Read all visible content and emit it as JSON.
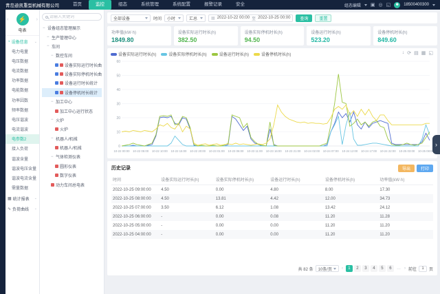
{
  "topbar": {
    "company": "青岛迪凯重型机械有限公司",
    "nav_items": [
      {
        "label": "首页",
        "active": false
      },
      {
        "label": "监控",
        "active": true
      },
      {
        "label": "组态",
        "active": false
      },
      {
        "label": "系统管理",
        "active": false
      },
      {
        "label": "系统配置",
        "active": false
      },
      {
        "label": "报警记录",
        "active": false
      },
      {
        "label": "安全",
        "active": false
      }
    ],
    "edit_label": "组态编辑",
    "icons": [
      {
        "name": "copy-icon",
        "glyph": "▣"
      },
      {
        "name": "location-icon",
        "glyph": "◎"
      },
      {
        "name": "fullscreen-icon",
        "glyph": "◱"
      }
    ],
    "avatar_glyph": "☻",
    "user_phone": "18500400300"
  },
  "sidebar": {
    "device_icon_glyph": "⚡",
    "device_label": "电表",
    "prev_caret": "‹",
    "next_caret": "›",
    "section": {
      "icon_glyph": "◔",
      "label": "设备信息",
      "caret": "⌄"
    },
    "items": [
      {
        "label": "电力电量",
        "active": false
      },
      {
        "label": "电压数据",
        "active": false
      },
      {
        "label": "电流数据",
        "active": false
      },
      {
        "label": "功率数据",
        "active": false
      },
      {
        "label": "电能数据",
        "active": false
      },
      {
        "label": "功率因数",
        "active": false
      },
      {
        "label": "频率数据",
        "active": false
      },
      {
        "label": "电压谐波",
        "active": false
      },
      {
        "label": "电流谐波",
        "active": false
      },
      {
        "label": "电参数2",
        "active": true
      },
      {
        "label": "接入负荷",
        "active": false
      },
      {
        "label": "谐波含量",
        "active": false
      },
      {
        "label": "谐波电压含量",
        "active": false
      },
      {
        "label": "谐波电流含量",
        "active": false
      },
      {
        "label": "需量数据",
        "active": false
      }
    ],
    "sections_bottom": [
      {
        "icon_glyph": "▦",
        "label": "统计报表",
        "caret": "⌄"
      },
      {
        "icon_glyph": "∿",
        "label": "负荷曲线",
        "caret": "⌄"
      }
    ]
  },
  "tree": {
    "search_placeholder": "请输入关键词",
    "nodes": [
      {
        "depth": 0,
        "label": "设备组态管理展示",
        "group": true,
        "icons": [],
        "selected": false
      },
      {
        "depth": 1,
        "label": "生产管理中心",
        "group": true,
        "icons": [],
        "selected": false
      },
      {
        "depth": 1,
        "label": "车间",
        "group": true,
        "icons": [],
        "selected": false
      },
      {
        "depth": 2,
        "label": "数控车间",
        "group": true,
        "icons": [],
        "selected": false
      },
      {
        "depth": 3,
        "label": "设备实际运行时长曲线",
        "group": false,
        "icons": [
          "blue",
          "red"
        ],
        "selected": false
      },
      {
        "depth": 3,
        "label": "设备实际停机时长曲线",
        "group": false,
        "icons": [
          "blue",
          "red"
        ],
        "selected": false
      },
      {
        "depth": 3,
        "label": "设备运行时长统计",
        "group": false,
        "icons": [
          "blue",
          "red"
        ],
        "selected": false
      },
      {
        "depth": 3,
        "label": "设备停机时长统计",
        "group": false,
        "icons": [
          "blue",
          "red"
        ],
        "selected": true
      },
      {
        "depth": 2,
        "label": "加工中心",
        "group": true,
        "icons": [],
        "selected": false
      },
      {
        "depth": 3,
        "label": "加工中心运行状态",
        "group": false,
        "icons": [
          "red"
        ],
        "selected": false
      },
      {
        "depth": 2,
        "label": "火炉",
        "group": true,
        "icons": [],
        "selected": false
      },
      {
        "depth": 3,
        "label": "火炉",
        "group": false,
        "icons": [
          "red"
        ],
        "selected": false
      },
      {
        "depth": 2,
        "label": "机器人/机械",
        "group": true,
        "icons": [],
        "selected": false
      },
      {
        "depth": 3,
        "label": "机器人/机械",
        "group": false,
        "icons": [
          "red"
        ],
        "selected": false
      },
      {
        "depth": 2,
        "label": "气体检测仪表",
        "group": true,
        "icons": [],
        "selected": false
      },
      {
        "depth": 3,
        "label": "圆形仪表",
        "group": false,
        "icons": [
          "red"
        ],
        "selected": false
      },
      {
        "depth": 3,
        "label": "数字仪表",
        "group": false,
        "icons": [
          "red"
        ],
        "selected": false
      },
      {
        "depth": 2,
        "label": "动力车间总电表",
        "group": false,
        "icons": [
          "red"
        ],
        "selected": false
      }
    ]
  },
  "filters": {
    "device_select": "全部设备",
    "time_label": "时间",
    "unit_select": "小时",
    "mode_select": "汇总",
    "calendar_glyph": "▦",
    "date_start": "2022-10-22 00:00",
    "date_sep": "至",
    "date_end": "2022-10-25 00:00",
    "search_btn": "查询",
    "reset_btn": "重置"
  },
  "stats": {
    "cards": [
      {
        "label": "功率值(kW·h)",
        "value": "1849.80",
        "color": "#1c8f7e"
      },
      {
        "label": "设备实际运行时长(h)",
        "value": "382.50",
        "color": "#52b54f"
      },
      {
        "label": "设备实际停机时长(h)",
        "value": "94.50",
        "color": "#52b54f"
      },
      {
        "label": "设备运行时长(h)",
        "value": "523.20",
        "color": "#23b7a4"
      },
      {
        "label": "设备停机时长(h)",
        "value": "849.60",
        "color": "#23b7a4"
      }
    ]
  },
  "chart_toolbox": [
    {
      "name": "download-icon",
      "glyph": "↓"
    },
    {
      "name": "refresh-icon",
      "glyph": "⟳"
    },
    {
      "name": "data-view-icon",
      "glyph": "▤"
    },
    {
      "name": "chart-type-icon",
      "glyph": "▦"
    },
    {
      "name": "fullscreen-icon",
      "glyph": "◱"
    }
  ],
  "chart_data": {
    "type": "line",
    "title": "",
    "xlabel": "",
    "ylabel": "",
    "ylim": [
      0,
      60
    ],
    "y_ticks": [
      0,
      10,
      20,
      30,
      40,
      50,
      60
    ],
    "grid": true,
    "legend_position": "top-left",
    "x_label_step": 5,
    "x_labels": [
      "10-22 00:00",
      "10-22 05:00",
      "10-22 10:00",
      "10-22 15:00",
      "10-22 20:00",
      "10-23 01:00",
      "10-23 06:00",
      "10-23 11:00",
      "10-23 16:00",
      "10-23 21:00",
      "10-24 02:00",
      "10-24 07:00",
      "10-24 12:00",
      "10-24 17:00",
      "10-24 22:00",
      "10-25 03:00",
      "10-25 08:00"
    ],
    "series": [
      {
        "name": "设备实际运行时长(h)",
        "color": "#4f6bd0",
        "values": [
          0,
          0,
          0,
          0.5,
          0,
          0,
          0,
          0.5,
          1,
          7,
          20,
          20.5,
          20,
          21,
          16,
          15,
          20,
          19,
          12,
          0.5,
          0,
          0,
          0,
          0,
          0,
          0,
          0,
          0,
          1,
          21,
          19,
          15,
          11,
          14,
          5,
          2,
          1,
          0,
          0,
          12,
          1,
          0,
          0,
          0,
          0,
          0,
          0,
          0,
          0,
          0,
          0,
          0,
          0,
          0,
          1,
          10,
          16,
          24,
          20,
          23,
          17,
          24,
          15,
          12,
          17,
          13,
          16,
          17,
          18,
          17,
          16,
          2,
          1,
          1,
          1,
          1,
          1,
          1,
          1,
          3,
          9,
          4
        ]
      },
      {
        "name": "设备实际停机时长(h)",
        "color": "#67c5e3",
        "values": [
          0,
          0,
          0,
          0,
          0,
          0,
          0,
          0,
          0,
          0,
          0,
          0,
          0,
          2,
          7,
          4,
          1,
          0,
          0,
          0,
          0,
          0,
          0,
          0,
          0,
          0,
          0,
          0,
          0,
          0,
          0,
          0,
          0,
          0,
          0,
          0,
          0,
          0,
          0,
          0,
          0,
          0,
          0,
          0,
          0,
          0,
          0,
          0,
          0,
          0,
          0,
          0,
          0,
          0,
          0,
          10,
          15,
          21,
          1,
          15,
          24,
          5,
          0.5,
          0.5,
          1,
          1.5,
          2,
          2,
          1.5,
          1,
          0.5,
          0,
          0,
          0,
          0,
          0,
          0,
          0,
          0,
          5,
          15,
          8
        ]
      },
      {
        "name": "设备运行时长(h)",
        "color": "#9cc641",
        "values": [
          0,
          0.5,
          1,
          2,
          1,
          0.5,
          0,
          1,
          2,
          8,
          21,
          21.5,
          21,
          22,
          15,
          16,
          21,
          20,
          13,
          1,
          0,
          0.5,
          0,
          0,
          0.5,
          0,
          0,
          0.5,
          2,
          22,
          21,
          20,
          13,
          16,
          6,
          3,
          1,
          0.5,
          0,
          17,
          0.5,
          0,
          0,
          0,
          0,
          0,
          0,
          0,
          0,
          0,
          0,
          0,
          0,
          1,
          2,
          15,
          30,
          51,
          31,
          30,
          14,
          16,
          19,
          15,
          17,
          14,
          17,
          18,
          14,
          13,
          5,
          1,
          0.5,
          0.5,
          1,
          2,
          1,
          0.5,
          1,
          2,
          6,
          10
        ]
      },
      {
        "name": "设备停机时长(h)",
        "color": "#ecd94a",
        "values": [
          10,
          10.5,
          10,
          11,
          10.5,
          10,
          11,
          10.5,
          10,
          12,
          15,
          14,
          16,
          13,
          12,
          16,
          10,
          14,
          12,
          2,
          0.5,
          1,
          1.5,
          0.5,
          1,
          1.5,
          0.5,
          1,
          1.5,
          1,
          2,
          1,
          1.5,
          1,
          0.5,
          1,
          1.5,
          1,
          2,
          5,
          15,
          29,
          24,
          21,
          19,
          18,
          17,
          16.5,
          17,
          16,
          16.5,
          16,
          16,
          15.5,
          16,
          20,
          26,
          28,
          26,
          29,
          22,
          25,
          21,
          26,
          22,
          26,
          21,
          18,
          22,
          22,
          18,
          15,
          15,
          15,
          15,
          15,
          15,
          15,
          15,
          15,
          16,
          16
        ]
      }
    ]
  },
  "table": {
    "title": "历史记录",
    "buttons": [
      {
        "label": "导出",
        "type": "warning"
      },
      {
        "label": "打印",
        "type": "blue"
      }
    ],
    "columns": [
      "时间",
      "设备实际运行时长(h)",
      "设备实际停机时长(h)",
      "设备运行时长(h)",
      "设备停机时长(h)",
      "功率值(kW·h)"
    ],
    "rows": [
      [
        "2022-10-25 09:00:00",
        "4.50",
        "0.00",
        "4.80",
        "8.00",
        "17.30"
      ],
      [
        "2022-10-25 08:00:00",
        "4.50",
        "13.81",
        "4.42",
        "12.00",
        "34.73"
      ],
      [
        "2022-10-25 07:00:00",
        "3.50",
        "6.12",
        "1.08",
        "13.42",
        "24.12"
      ],
      [
        "2022-10-25 06:00:00",
        "-",
        "0.00",
        "0.08",
        "11.20",
        "11.28"
      ],
      [
        "2022-10-25 05:00:00",
        "-",
        "0.00",
        "0.00",
        "11.20",
        "11.20"
      ],
      [
        "2022-10-25 04:00:00",
        "-",
        "0.00",
        "0.00",
        "11.20",
        "11.20"
      ]
    ]
  },
  "pagination": {
    "total_text": "共 82 条",
    "page_size": "10条/页",
    "prev": "‹",
    "pages": [
      "1",
      "2",
      "3",
      "4",
      "5",
      "6"
    ],
    "active_page": "1",
    "ellipsis": "…",
    "next": "›",
    "goto_label": "前往",
    "goto_value": "1",
    "goto_suffix": "页"
  },
  "float_chevron": "›"
}
